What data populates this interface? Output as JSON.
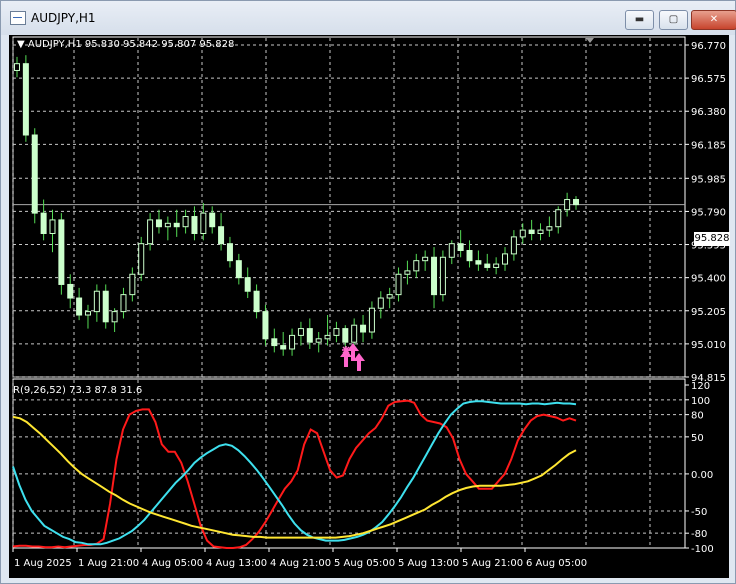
{
  "window": {
    "title": "AUDJPY,H1",
    "buttons": {
      "minimize": "▬",
      "maximize": "▢",
      "close": "✕"
    }
  },
  "main_chart": {
    "header": "AUDJPY,H1  95.830 95.842 95.807 95.828",
    "price_label": "95.828",
    "y_axis": [
      "96.770",
      "96.575",
      "96.380",
      "96.185",
      "95.985",
      "95.790",
      "95.595",
      "95.400",
      "95.205",
      "95.010",
      "94.815"
    ]
  },
  "indicator": {
    "header": "R(9,26,52) 73.3 87.8 31.6",
    "y_axis": [
      "120",
      "100",
      "80",
      "50",
      "0.00",
      "-50",
      "-80",
      "-100"
    ]
  },
  "x_axis": [
    "1 Aug 2025",
    "1 Aug 21:00",
    "4 Aug 05:00",
    "4 Aug 13:00",
    "4 Aug 21:00",
    "5 Aug 05:00",
    "5 Aug 13:00",
    "5 Aug 21:00",
    "6 Aug 05:00"
  ],
  "chart_data": [
    {
      "type": "candlestick",
      "title": "AUDJPY,H1",
      "ylim": [
        94.815,
        96.77
      ],
      "ohlc": [
        [
          96.62,
          96.7,
          96.58,
          96.66
        ],
        [
          96.66,
          96.71,
          96.2,
          96.24
        ],
        [
          96.24,
          96.28,
          95.72,
          95.78
        ],
        [
          95.78,
          95.86,
          95.62,
          95.66
        ],
        [
          95.66,
          95.8,
          95.55,
          95.74
        ],
        [
          95.74,
          95.78,
          95.3,
          95.36
        ],
        [
          95.36,
          95.42,
          95.22,
          95.28
        ],
        [
          95.28,
          95.34,
          95.15,
          95.18
        ],
        [
          95.18,
          95.24,
          95.1,
          95.2
        ],
        [
          95.2,
          95.36,
          95.14,
          95.32
        ],
        [
          95.32,
          95.36,
          95.1,
          95.14
        ],
        [
          95.14,
          95.22,
          95.08,
          95.2
        ],
        [
          95.2,
          95.34,
          95.16,
          95.3
        ],
        [
          95.3,
          95.46,
          95.26,
          95.42
        ],
        [
          95.42,
          95.64,
          95.38,
          95.6
        ],
        [
          95.6,
          95.78,
          95.56,
          95.74
        ],
        [
          95.74,
          95.8,
          95.66,
          95.7
        ],
        [
          95.7,
          95.76,
          95.62,
          95.72
        ],
        [
          95.72,
          95.8,
          95.64,
          95.7
        ],
        [
          95.7,
          95.8,
          95.66,
          95.76
        ],
        [
          95.76,
          95.82,
          95.62,
          95.66
        ],
        [
          95.66,
          95.84,
          95.62,
          95.78
        ],
        [
          95.78,
          95.82,
          95.66,
          95.7
        ],
        [
          95.7,
          95.78,
          95.56,
          95.6
        ],
        [
          95.6,
          95.64,
          95.46,
          95.5
        ],
        [
          95.5,
          95.54,
          95.36,
          95.4
        ],
        [
          95.4,
          95.46,
          95.28,
          95.32
        ],
        [
          95.32,
          95.36,
          95.16,
          95.2
        ],
        [
          95.2,
          95.24,
          95.0,
          95.04
        ],
        [
          95.04,
          95.1,
          94.96,
          95.0
        ],
        [
          95.0,
          95.08,
          94.94,
          94.98
        ],
        [
          94.98,
          95.1,
          94.94,
          95.06
        ],
        [
          95.06,
          95.14,
          95.0,
          95.1
        ],
        [
          95.1,
          95.16,
          94.98,
          95.02
        ],
        [
          95.02,
          95.08,
          94.96,
          95.04
        ],
        [
          95.04,
          95.18,
          95.0,
          95.06
        ],
        [
          95.06,
          95.14,
          95.02,
          95.1
        ],
        [
          95.1,
          95.12,
          94.96,
          95.02
        ],
        [
          95.02,
          95.16,
          94.98,
          95.12
        ],
        [
          95.12,
          95.18,
          95.02,
          95.08
        ],
        [
          95.08,
          95.26,
          95.04,
          95.22
        ],
        [
          95.22,
          95.32,
          95.16,
          95.28
        ],
        [
          95.28,
          95.34,
          95.22,
          95.3
        ],
        [
          95.3,
          95.46,
          95.26,
          95.42
        ],
        [
          95.42,
          95.5,
          95.36,
          95.44
        ],
        [
          95.44,
          95.54,
          95.4,
          95.5
        ],
        [
          95.5,
          95.56,
          95.44,
          95.52
        ],
        [
          95.52,
          95.58,
          95.22,
          95.3
        ],
        [
          95.3,
          95.56,
          95.26,
          95.52
        ],
        [
          95.52,
          95.62,
          95.48,
          95.6
        ],
        [
          95.6,
          95.68,
          95.52,
          95.56
        ],
        [
          95.56,
          95.62,
          95.46,
          95.5
        ],
        [
          95.5,
          95.56,
          95.44,
          95.48
        ],
        [
          95.48,
          95.54,
          95.44,
          95.46
        ],
        [
          95.46,
          95.52,
          95.42,
          95.48
        ],
        [
          95.48,
          95.58,
          95.44,
          95.54
        ],
        [
          95.54,
          95.68,
          95.5,
          95.64
        ],
        [
          95.64,
          95.72,
          95.6,
          95.68
        ],
        [
          95.68,
          95.74,
          95.62,
          95.66
        ],
        [
          95.66,
          95.72,
          95.62,
          95.68
        ],
        [
          95.68,
          95.76,
          95.64,
          95.7
        ],
        [
          95.7,
          95.82,
          95.66,
          95.8
        ],
        [
          95.8,
          95.9,
          95.76,
          95.86
        ],
        [
          95.86,
          95.88,
          95.8,
          95.83
        ]
      ]
    },
    {
      "type": "line",
      "title": "R(9,26,52) 73.3 87.8 31.6",
      "ylim": [
        -100,
        120
      ],
      "series": [
        {
          "name": "9",
          "color": "#ff1a1a",
          "values": [
            -98,
            -97,
            -97,
            -98,
            -98,
            -99,
            -99,
            -98,
            -99,
            -98,
            -97,
            -96,
            -96,
            -94,
            -88,
            -40,
            20,
            60,
            80,
            85,
            87,
            87,
            70,
            40,
            30,
            30,
            15,
            -10,
            -40,
            -70,
            -90,
            -98,
            -99,
            -100,
            -100,
            -99,
            -96,
            -88,
            -78,
            -65,
            -50,
            -35,
            -20,
            -10,
            5,
            40,
            60,
            55,
            30,
            5,
            -5,
            -2,
            20,
            35,
            45,
            55,
            62,
            75,
            92,
            97,
            98,
            99,
            96,
            80,
            72,
            70,
            68,
            63,
            48,
            20,
            0,
            -10,
            -20,
            -20,
            -20,
            -10,
            0,
            20,
            45,
            60,
            72,
            78,
            80,
            78,
            76,
            72,
            75,
            72
          ]
        },
        {
          "name": "26",
          "color": "#3ee0ee",
          "values": [
            10,
            -15,
            -35,
            -50,
            -60,
            -70,
            -75,
            -80,
            -85,
            -88,
            -92,
            -93,
            -95,
            -95,
            -95,
            -93,
            -90,
            -87,
            -82,
            -77,
            -70,
            -62,
            -52,
            -42,
            -32,
            -22,
            -12,
            -4,
            5,
            15,
            22,
            28,
            33,
            38,
            40,
            38,
            32,
            24,
            15,
            5,
            -6,
            -18,
            -30,
            -42,
            -55,
            -67,
            -76,
            -82,
            -86,
            -88,
            -90,
            -90,
            -90,
            -89,
            -87,
            -85,
            -82,
            -78,
            -72,
            -65,
            -55,
            -44,
            -32,
            -18,
            -5,
            10,
            25,
            40,
            55,
            68,
            80,
            88,
            95,
            97,
            98,
            98,
            97,
            96,
            95,
            95,
            95,
            95,
            94,
            95,
            95,
            94,
            95,
            96,
            95,
            95,
            94
          ]
        },
        {
          "name": "52",
          "color": "#ffe632",
          "values": [
            77,
            75,
            70,
            62,
            54,
            45,
            36,
            27,
            17,
            8,
            0,
            -6,
            -12,
            -18,
            -24,
            -29,
            -35,
            -40,
            -44,
            -48,
            -52,
            -55,
            -58,
            -61,
            -64,
            -67,
            -70,
            -72,
            -74,
            -76,
            -78,
            -80,
            -82,
            -83,
            -84,
            -85,
            -85,
            -86,
            -86,
            -86,
            -86,
            -86,
            -86,
            -86,
            -86,
            -86,
            -86,
            -86,
            -85,
            -84,
            -82,
            -80,
            -77,
            -74,
            -71,
            -68,
            -64,
            -60,
            -56,
            -52,
            -48,
            -42,
            -37,
            -31,
            -26,
            -22,
            -19,
            -17,
            -16,
            -16,
            -16,
            -16,
            -15,
            -14,
            -12,
            -10,
            -6,
            -2,
            5,
            12,
            20,
            27,
            32
          ]
        }
      ]
    }
  ],
  "colors": {
    "background": "#000000",
    "grid": "#c8c8c8",
    "candle": "#ccffcc",
    "wick": "#55dd55",
    "arrow": "#ff66cc"
  }
}
